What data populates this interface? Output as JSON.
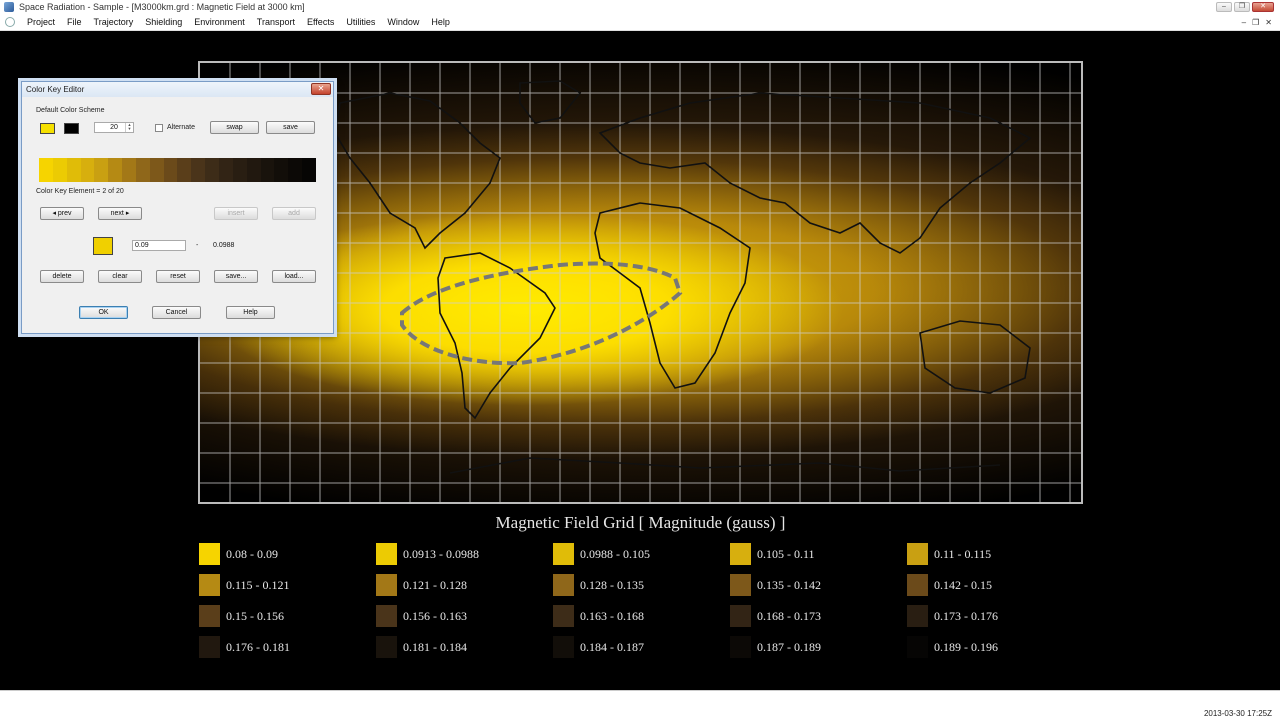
{
  "window": {
    "title": "Space Radiation - Sample - [M3000km.grd : Magnetic Field at 3000 km]",
    "min": "–",
    "restore": "❐",
    "close": "✕"
  },
  "menu": {
    "items": [
      "Project",
      "File",
      "Trajectory",
      "Shielding",
      "Environment",
      "Transport",
      "Effects",
      "Utilities",
      "Window",
      "Help"
    ],
    "mdi_min": "–",
    "mdi_restore": "❐",
    "mdi_close": "✕"
  },
  "map": {
    "title": "Magnetic Field Grid  [ Magnitude (gauss) ]"
  },
  "legend": [
    {
      "label": "0.08 - 0.09",
      "color": "#f6d400"
    },
    {
      "label": "0.0913 - 0.0988",
      "color": "#eccb03"
    },
    {
      "label": "0.0988 - 0.105",
      "color": "#e0bc08"
    },
    {
      "label": "0.105 - 0.11",
      "color": "#d7af0e"
    },
    {
      "label": "0.11 - 0.115",
      "color": "#c9a012"
    },
    {
      "label": "0.115 - 0.121",
      "color": "#b58a14"
    },
    {
      "label": "0.121 - 0.128",
      "color": "#a37817"
    },
    {
      "label": "0.128 - 0.135",
      "color": "#8f671a"
    },
    {
      "label": "0.135 - 0.142",
      "color": "#7d581a"
    },
    {
      "label": "0.142 - 0.15",
      "color": "#6b4a1a"
    },
    {
      "label": "0.15 - 0.156",
      "color": "#5a3e1a"
    },
    {
      "label": "0.156 - 0.163",
      "color": "#4a341a"
    },
    {
      "label": "0.163 - 0.168",
      "color": "#3d2c18"
    },
    {
      "label": "0.168 - 0.173",
      "color": "#322415"
    },
    {
      "label": "0.173 - 0.176",
      "color": "#291e12"
    },
    {
      "label": "0.176 - 0.181",
      "color": "#21180f"
    },
    {
      "label": "0.181 - 0.184",
      "color": "#19130c"
    },
    {
      "label": "0.184 - 0.187",
      "color": "#120e09"
    },
    {
      "label": "0.187 - 0.189",
      "color": "#0c0906"
    },
    {
      "label": "0.189 - 0.196",
      "color": "#060504"
    }
  ],
  "status": {
    "timestamp": "2013-03-30 17:25Z"
  },
  "dialog": {
    "title": "Color Key Editor",
    "close": "✕",
    "scheme_label": "Default Color Scheme",
    "scheme_color1": "#f5e000",
    "scheme_color2": "#000000",
    "count": "20",
    "alternate_label": "Alternate",
    "swap": "swap",
    "save": "save",
    "element_label": "Color Key Element = 2 of 20",
    "prev": "◂ prev",
    "next": "next ▸",
    "insert": "insert",
    "add": "add",
    "element_color": "#f0d000",
    "range_min": "0.09",
    "range_sep": "-",
    "range_max": "0.0988",
    "delete": "delete",
    "clear": "clear",
    "reset": "reset",
    "save_as": "save...",
    "load": "load...",
    "ok": "OK",
    "cancel": "Cancel",
    "help": "Help"
  }
}
